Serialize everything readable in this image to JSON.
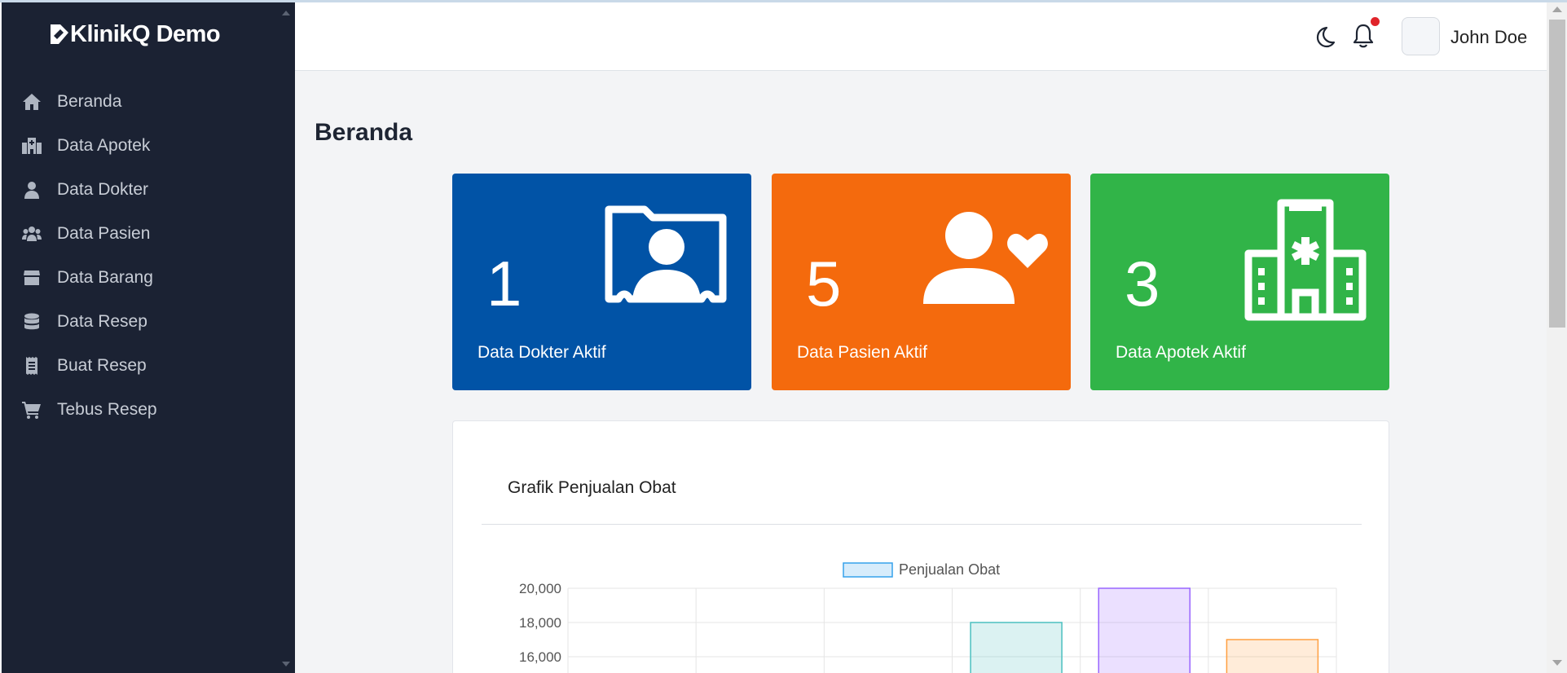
{
  "brand": {
    "name": "KlinikQ Demo"
  },
  "sidebar": {
    "items": [
      {
        "label": "Beranda",
        "icon": "home-icon"
      },
      {
        "label": "Data Apotek",
        "icon": "hospital-icon"
      },
      {
        "label": "Data Dokter",
        "icon": "doctor-icon"
      },
      {
        "label": "Data Pasien",
        "icon": "users-icon"
      },
      {
        "label": "Data Barang",
        "icon": "box-icon"
      },
      {
        "label": "Data Resep",
        "icon": "database-icon"
      },
      {
        "label": "Buat Resep",
        "icon": "receipt-icon"
      },
      {
        "label": "Tebus Resep",
        "icon": "cart-icon"
      }
    ]
  },
  "topbar": {
    "theme_icon": "moon-icon",
    "notification_icon": "bell-icon",
    "user_name": "John Doe"
  },
  "page": {
    "title": "Beranda"
  },
  "stats": [
    {
      "value": "1",
      "label": "Data Dokter Aktif",
      "color": "#0153a6",
      "icon": "doctor-folder-icon"
    },
    {
      "value": "5",
      "label": "Data Pasien Aktif",
      "color": "#f46a0d",
      "icon": "user-heart-icon"
    },
    {
      "value": "3",
      "label": "Data Apotek Aktif",
      "color": "#31b448",
      "icon": "hospital-building-icon"
    }
  ],
  "chart_panel": {
    "title": "Grafik Penjualan Obat"
  },
  "chart_data": {
    "type": "bar",
    "categories": [
      "",
      "",
      "",
      "",
      "",
      ""
    ],
    "series": [
      {
        "name": "Penjualan Obat",
        "values": [
          null,
          null,
          null,
          18000,
          20000,
          17000
        ]
      }
    ],
    "bar_colors": [
      "#ff6384",
      "#36a2eb",
      "#ffce56",
      "#4bc0c0",
      "#9966ff",
      "#ff9f40"
    ],
    "y_ticks": [
      "20,000",
      "18,000",
      "16,000"
    ],
    "ylim_visible": [
      16000,
      20000
    ],
    "legend": "top",
    "grid": true
  }
}
